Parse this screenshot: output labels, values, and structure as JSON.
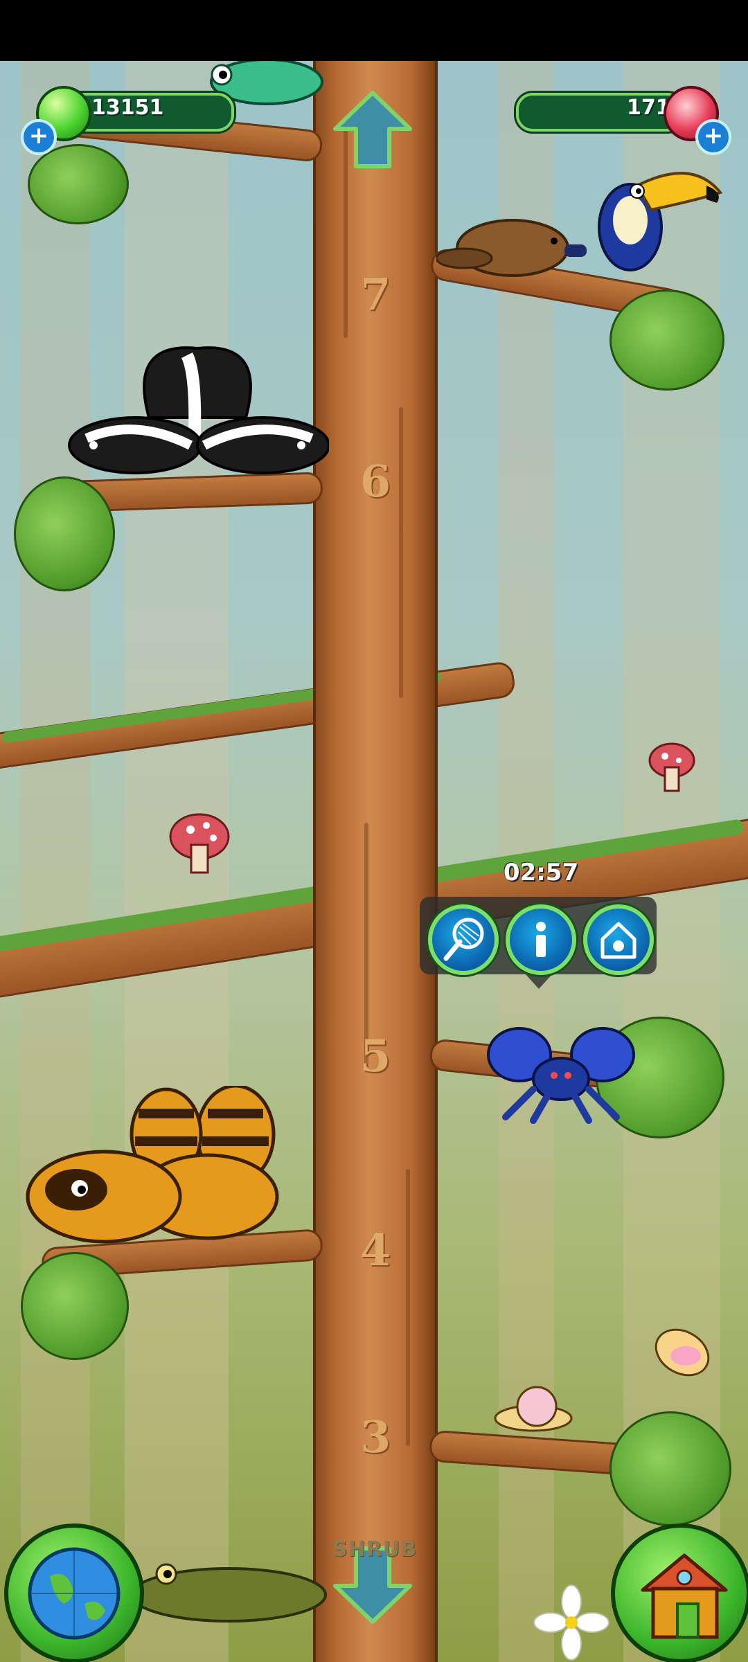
{
  "hud": {
    "green_currency": "13151",
    "red_currency": "171"
  },
  "trunk_levels": [
    "7",
    "6",
    "5",
    "4",
    "3"
  ],
  "popup": {
    "timer": "02:57",
    "buttons": [
      "catch-net-icon",
      "info-icon",
      "house-icon"
    ]
  },
  "area_label": "SHRUB",
  "creatures": [
    "chameleon",
    "toucan",
    "platypus",
    "skunk-pair",
    "blue-tarantula",
    "raccoon-dog-pair",
    "snail",
    "yellow-bird",
    "crocodile"
  ],
  "colors": {
    "hud_bg": "#0f5a2e",
    "hud_border": "#7fd36b",
    "trunk": "#b86b33",
    "accent_green": "#4cd32f",
    "accent_red": "#e63a55"
  }
}
